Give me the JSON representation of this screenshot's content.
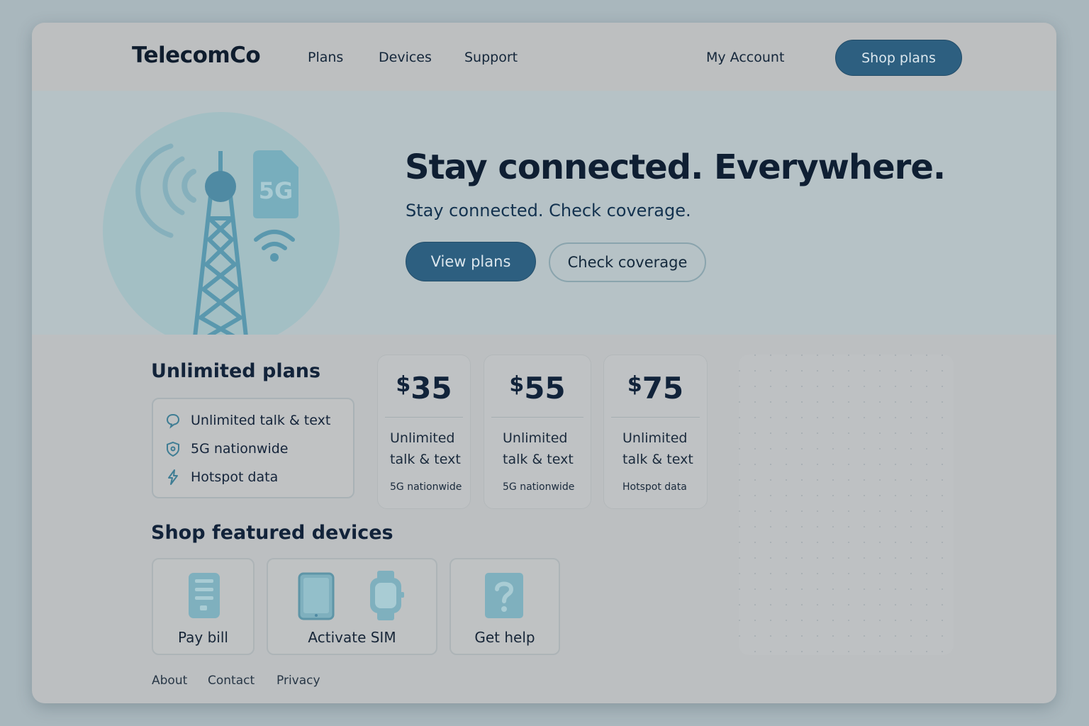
{
  "header": {
    "logo": "TelecomCo",
    "nav": [
      "Plans",
      "Devices",
      "Support"
    ],
    "account": "My Account",
    "cta": "Shop plans"
  },
  "hero": {
    "sim_label": "5G",
    "title": "Stay connected. Everywhere.",
    "subtitle": "Stay connected. Check coverage.",
    "primary_button": "View plans",
    "secondary_button": "Check coverage"
  },
  "plans": {
    "title": "Unlimited plans",
    "features": [
      {
        "icon": "chat-bubble-icon",
        "label": "Unlimited talk & text"
      },
      {
        "icon": "shield-icon",
        "label": "5G nationwide"
      },
      {
        "icon": "bolt-icon",
        "label": "Hotspot data"
      }
    ],
    "cards": [
      {
        "currency": "$",
        "amount": "35",
        "line1": "Unlimited",
        "line2": "talk & text",
        "note": "5G nationwide"
      },
      {
        "currency": "$",
        "amount": "55",
        "line1": "Unlimited",
        "line2": "talk & text",
        "note": "5G nationwide"
      },
      {
        "currency": "$",
        "amount": "75",
        "line1": "Unlimited",
        "line2": "talk & text",
        "note": "Hotspot data"
      }
    ]
  },
  "devices": {
    "title": "Shop featured devices",
    "tiles": [
      {
        "icon": "phone-icon",
        "label": "Pay bill"
      },
      {
        "icon": "tablet-watch-icon",
        "label": "Activate SIM"
      },
      {
        "icon": "question-icon",
        "label": "Get help"
      }
    ]
  },
  "footer": {
    "links": [
      "About",
      "Contact",
      "Privacy"
    ]
  },
  "colors": {
    "primary": "#2d5f80",
    "accent_teal": "#5e9db0",
    "text_dark": "#0f1f33"
  }
}
